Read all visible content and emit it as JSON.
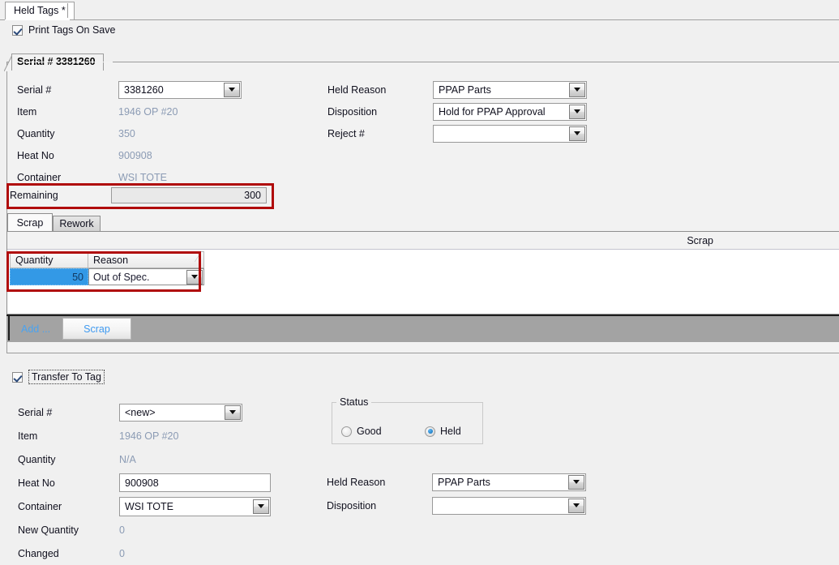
{
  "window": {
    "document_tab": "Held Tags *",
    "print_tags_checkbox": {
      "label": "Print Tags On Save",
      "checked": true
    }
  },
  "serial_panel": {
    "tab_title": "Serial # 3381260",
    "left_fields": [
      {
        "label": "Serial #",
        "value": "3381260",
        "type": "combo"
      },
      {
        "label": "Item",
        "value": "1946 OP #20",
        "type": "static"
      },
      {
        "label": "Quantity",
        "value": "350",
        "type": "static"
      },
      {
        "label": "Heat No",
        "value": "900908",
        "type": "static"
      },
      {
        "label": "Container",
        "value": "WSI TOTE",
        "type": "static"
      }
    ],
    "right_fields": [
      {
        "label": "Held Reason",
        "value": "PPAP Parts",
        "type": "combo"
      },
      {
        "label": "Disposition",
        "value": "Hold for PPAP Approval",
        "type": "combo"
      },
      {
        "label": "Reject #",
        "value": "",
        "type": "combo"
      }
    ],
    "remaining": {
      "label": "Remaining",
      "value": "300",
      "highlighted": true,
      "highlight_color": "#b00b0b"
    }
  },
  "scrap_section": {
    "tabs": [
      {
        "label": "Scrap",
        "active": true
      },
      {
        "label": "Rework",
        "active": false
      }
    ],
    "grid_caption": "Scrap",
    "columns": [
      {
        "label": "Quantity",
        "sort_mark": ""
      },
      {
        "label": "Reason",
        "sort_mark": "⁄"
      }
    ],
    "rows": [
      {
        "quantity": "50",
        "reason": "Out of Spec.",
        "selected": true
      }
    ],
    "highlighted": true,
    "toolbar": {
      "add_link": "Add ...",
      "scrap_button": "Scrap"
    }
  },
  "transfer_section": {
    "checkbox": {
      "label": "Transfer To Tag",
      "checked": true,
      "focused": true
    },
    "left_fields": [
      {
        "label": "Serial #",
        "value": "<new>",
        "type": "combo"
      },
      {
        "label": "Item",
        "value": "1946 OP #20",
        "type": "static"
      },
      {
        "label": "Quantity",
        "value": "N/A",
        "type": "static"
      },
      {
        "label": "Heat No",
        "value": "900908",
        "type": "text"
      },
      {
        "label": "Container",
        "value": "WSI TOTE",
        "type": "combo"
      },
      {
        "label": "New Quantity",
        "value": "0",
        "type": "static"
      },
      {
        "label": "Changed",
        "value": "0",
        "type": "static"
      }
    ],
    "status_group": {
      "title": "Status",
      "options": [
        {
          "label": "Good",
          "selected": false
        },
        {
          "label": "Held",
          "selected": true
        }
      ]
    },
    "right_fields": [
      {
        "label": "Held Reason",
        "value": "PPAP Parts",
        "type": "combo"
      },
      {
        "label": "Disposition",
        "value": "",
        "type": "combo"
      }
    ]
  },
  "theme": {
    "background": "#f0f0f0",
    "panel_background": "#f2f2f2",
    "static_text_color": "#8b9bb4",
    "selection_blue": "#3399e6",
    "link_blue": "#4aa3f0",
    "toolbar_gray": "#a3a3a3"
  }
}
